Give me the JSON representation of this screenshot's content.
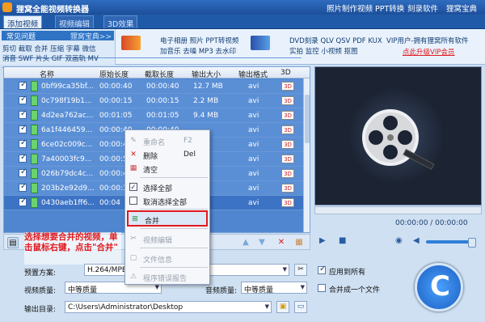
{
  "title": "狸窝全能视频转换器",
  "menu": [
    "照片制作视频",
    "PPT转换",
    "刻录软件",
    "狸窝宝典"
  ],
  "tabs": [
    "添加视频",
    "视频编辑",
    "3D效果"
  ],
  "faq": {
    "header": "常见问题",
    "header_right": "狸窝宝典>>",
    "rows": [
      "剪切 截取 合并 压缩 字幕 微信",
      "消音 SWF 片头 GIF 双画轨 MV"
    ]
  },
  "promo": {
    "a1": "电子相册 照片 PPT转视频",
    "a2": "加音乐 去噪 MP3 去水印",
    "b1": "DVD刻录 QLV QSV PDF KUX",
    "b2": "实拍 监控 小视频 抠图",
    "vip1": "VIP用户-拥有狸窝所有软件",
    "vip2": "点此升级VIP会员"
  },
  "table": {
    "headers": [
      "名称",
      "原始长度",
      "截取长度",
      "输出大小",
      "输出格式",
      "3D"
    ],
    "rows": [
      {
        "name": "0bf99ca35bf...",
        "orig": "00:00:40",
        "cut": "00:00:40",
        "size": "12.7 MB",
        "fmt": "avi"
      },
      {
        "name": "0c798f19b1...",
        "orig": "00:00:15",
        "cut": "00:00:15",
        "size": "2.2 MB",
        "fmt": "avi"
      },
      {
        "name": "4d2ea762ac...",
        "orig": "00:01:05",
        "cut": "00:01:05",
        "size": "9.4 MB",
        "fmt": "avi"
      },
      {
        "name": "6a1f446459...",
        "orig": "00:00:40",
        "cut": "00:00:40",
        "size": "",
        "fmt": "avi"
      },
      {
        "name": "6ce02c009c...",
        "orig": "00:00:40",
        "cut": "",
        "size": "",
        "fmt": "avi"
      },
      {
        "name": "7a40003fc9...",
        "orig": "00:00:50",
        "cut": "",
        "size": "",
        "fmt": "avi"
      },
      {
        "name": "026b79dc4c...",
        "orig": "00:00:45",
        "cut": "",
        "size": "",
        "fmt": "avi"
      },
      {
        "name": "203b2e92d9...",
        "orig": "00:00:30",
        "cut": "",
        "size": "",
        "fmt": "avi"
      },
      {
        "name": "0430aeb1ff6...",
        "orig": "00:04",
        "cut": "",
        "size": "",
        "fmt": "avi"
      }
    ],
    "badge": "3D"
  },
  "context_menu": {
    "rename": "重命名",
    "rename_key": "F2",
    "delete": "删除",
    "delete_key": "Del",
    "clear": "清空",
    "select_all": "选择全部",
    "deselect_all": "取消选择全部",
    "merge": "合并",
    "edit": "视频编辑",
    "info": "文件信息",
    "report": "程序错误报告"
  },
  "callout": "选择想要合并的视频，单击鼠标右键，点击\"合并\"",
  "preview": {
    "time": "00:00:00 / 00:00:00"
  },
  "settings": {
    "preset_label": "预置方案:",
    "preset_value": "H.264/MPEG-4 AVC",
    "apply_all": "应用到所有",
    "vq_label": "视频质量:",
    "vq_value": "中等质量",
    "aq_label": "音频质量:",
    "aq_value": "中等质量",
    "merge_one": "合并成一个文件",
    "out_label": "输出目录:",
    "out_value": "C:\\Users\\Administrator\\Desktop"
  }
}
